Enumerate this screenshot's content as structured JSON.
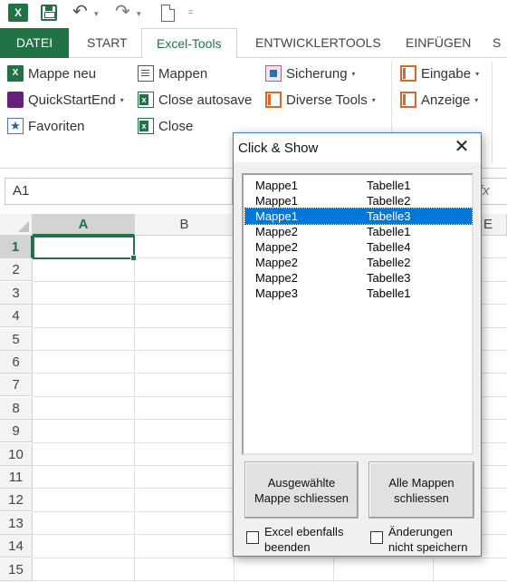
{
  "qat": {
    "app_icon": "excel-logo-icon",
    "logo_text": "X",
    "save_icon": "save-icon",
    "undo_glyph": "↶",
    "redo_glyph": "↷",
    "new_icon": "new-document-icon",
    "caret": "▾",
    "qat_more": "="
  },
  "tabs": {
    "file": "DATEI",
    "start": "START",
    "excel_tools": "Excel-Tools",
    "developer": "ENTWICKLERTOOLS",
    "insert": "EINFÜGEN",
    "cut_off": "S"
  },
  "ribbon": {
    "mappe_neu": "Mappe neu",
    "quickstartend": "QuickStartEnd",
    "favoriten": "Favoriten",
    "mappen": "Mappen",
    "close_autosave": "Close autosave",
    "close": "Close",
    "sicherung": "Sicherung",
    "diverse_tools": "Diverse Tools",
    "eingabe": "Eingabe",
    "anzeige": "Anzeige",
    "dropdown_glyph": "▾"
  },
  "formula_bar": {
    "name_box": "A1",
    "fx": "fx"
  },
  "grid": {
    "columns": [
      "A",
      "B"
    ],
    "cut_column": "E",
    "rows": [
      "1",
      "2",
      "3",
      "4",
      "5",
      "6",
      "7",
      "8",
      "9",
      "10",
      "11",
      "12",
      "13",
      "14",
      "15"
    ]
  },
  "dialog": {
    "title": "Click & Show",
    "close_glyph": "✕",
    "list": [
      {
        "workbook": "Mappe1",
        "sheet": "Tabelle1"
      },
      {
        "workbook": "Mappe1",
        "sheet": "Tabelle2"
      },
      {
        "workbook": "Mappe1",
        "sheet": "Tabelle3"
      },
      {
        "workbook": "Mappe2",
        "sheet": "Tabelle1"
      },
      {
        "workbook": "Mappe2",
        "sheet": "Tabelle4"
      },
      {
        "workbook": "Mappe2",
        "sheet": "Tabelle2"
      },
      {
        "workbook": "Mappe2",
        "sheet": "Tabelle3"
      },
      {
        "workbook": "Mappe3",
        "sheet": "Tabelle1"
      }
    ],
    "selected_index": 2,
    "btn_close_selected": "Ausgewählte\nMappe schliessen",
    "btn_close_all": "Alle Mappen\nschliessen",
    "chk_excel_quit": "Excel ebenfalls\nbeenden",
    "chk_no_save": "Änderungen\nnicht speichern"
  },
  "colors": {
    "excel_green": "#217346",
    "selection_blue": "#0078d7",
    "dialog_border": "#3f7fc5"
  }
}
